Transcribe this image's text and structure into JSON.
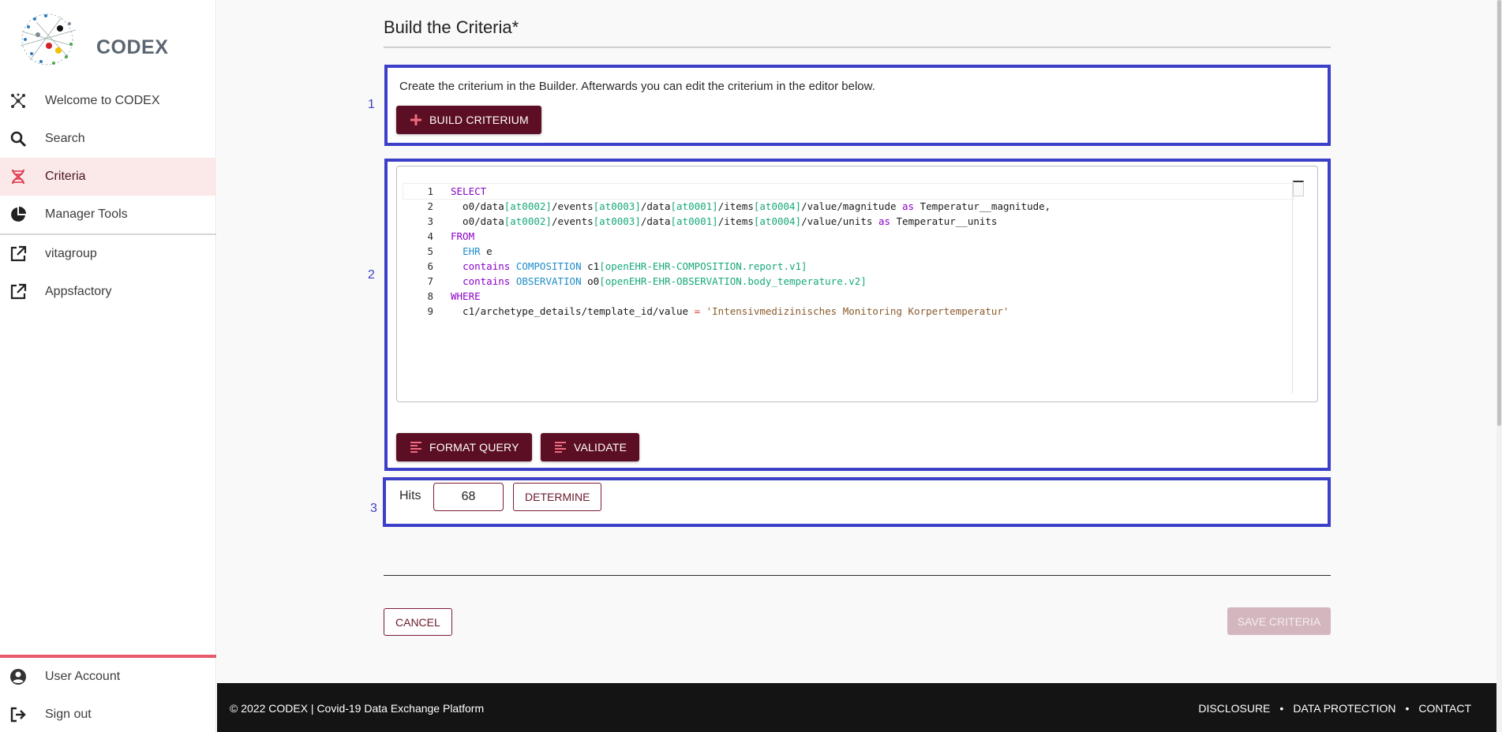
{
  "app": {
    "logo_text": "CODEX"
  },
  "sidebar": {
    "items": [
      {
        "label": "Welcome to CODEX",
        "icon": "molecule-icon"
      },
      {
        "label": "Search",
        "icon": "search-icon"
      },
      {
        "label": "Criteria",
        "icon": "dna-icon",
        "active": true
      },
      {
        "label": "Manager Tools",
        "icon": "pie-chart-icon"
      },
      {
        "label": "vitagroup",
        "icon": "external-link-icon"
      },
      {
        "label": "Appsfactory",
        "icon": "external-link-icon"
      }
    ],
    "bottom_items": [
      {
        "label": "User Account",
        "icon": "account-circle-icon"
      },
      {
        "label": "Sign out",
        "icon": "sign-out-icon"
      }
    ]
  },
  "main": {
    "section_title": "Build the Criteria*",
    "steps": [
      "1",
      "2",
      "3"
    ],
    "builder": {
      "hint": "Create the criterium in the Builder. Afterwards you can edit the criterium in the editor below.",
      "build_button": "BUILD CRITERIUM"
    },
    "editor": {
      "lines": [
        "1",
        "2",
        "3",
        "4",
        "5",
        "6",
        "7",
        "8",
        "9"
      ]
    },
    "actions": {
      "format_button": "FORMAT QUERY",
      "validate_button": "VALIDATE"
    },
    "hits": {
      "label": "Hits",
      "value": "68",
      "determine_button": "DETERMINE"
    },
    "cancel_button": "CANCEL",
    "save_button": "SAVE CRITERIA"
  },
  "footer": {
    "copyright": "© 2022 CODEX | Covid-19 Data Exchange Platform",
    "links": [
      "DISCLOSURE",
      "DATA PROTECTION",
      "CONTACT"
    ]
  },
  "colors": {
    "primary": "#5c0f24",
    "step_border": "#3c3fc8",
    "active_bg": "#fbe9ea",
    "accent_line": "#e85a6a"
  }
}
